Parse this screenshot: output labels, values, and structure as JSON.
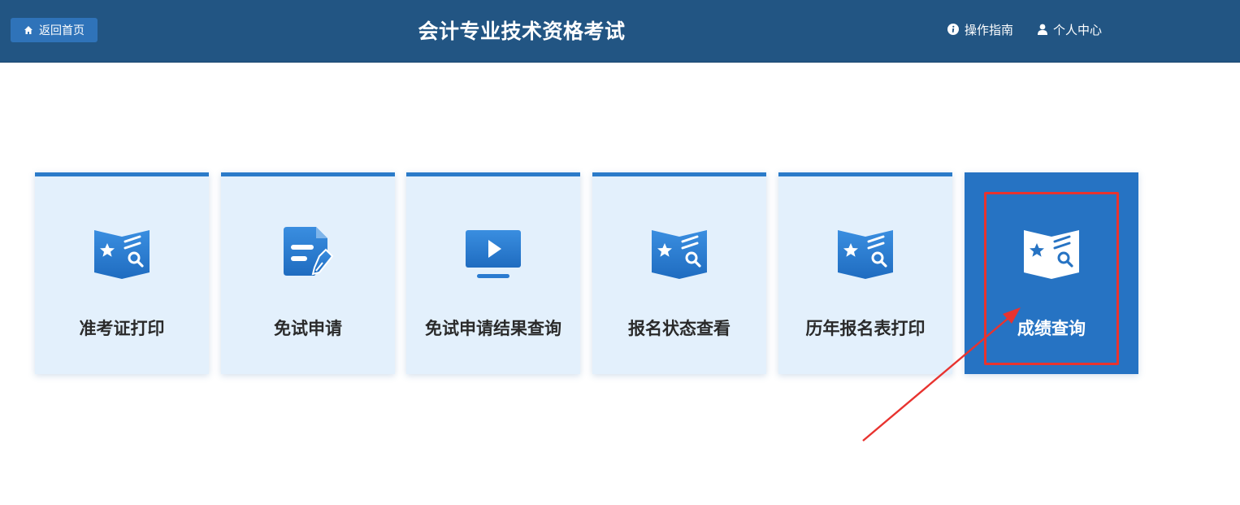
{
  "header": {
    "back_label": "返回首页",
    "title": "会计专业技术资格考试",
    "guide_label": "操作指南",
    "user_label": "个人中心"
  },
  "cards": [
    {
      "label": "准考证打印",
      "icon": "certificate-search-icon"
    },
    {
      "label": "免试申请",
      "icon": "document-edit-icon"
    },
    {
      "label": "免试申请结果查询",
      "icon": "video-play-icon"
    },
    {
      "label": "报名状态查看",
      "icon": "certificate-search-icon"
    },
    {
      "label": "历年报名表打印",
      "icon": "certificate-search-icon"
    },
    {
      "label": "成绩查询",
      "icon": "certificate-search-icon",
      "active": true
    }
  ],
  "colors": {
    "header_bg": "#225583",
    "accent": "#2673c3",
    "card_bg": "#e3f0fc",
    "annotation": "#e8332f"
  }
}
